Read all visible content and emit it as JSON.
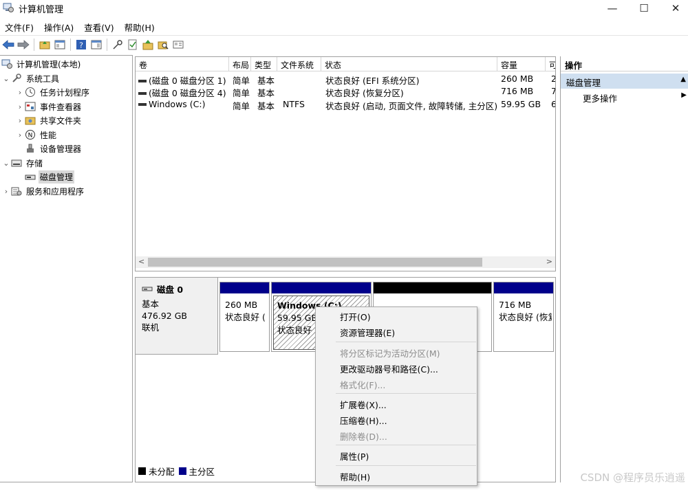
{
  "window": {
    "title": "计算机管理",
    "minimize": "—",
    "maximize": "☐",
    "close": "✕"
  },
  "menubar": [
    "文件(F)",
    "操作(A)",
    "查看(V)",
    "帮助(H)"
  ],
  "tree": {
    "root": "计算机管理(本地)",
    "system_tools": "系统工具",
    "task_scheduler": "任务计划程序",
    "event_viewer": "事件查看器",
    "shared_folders": "共享文件夹",
    "performance": "性能",
    "device_manager": "设备管理器",
    "storage": "存储",
    "disk_management": "磁盘管理",
    "services_apps": "服务和应用程序"
  },
  "volume_list": {
    "columns": [
      "卷",
      "布局",
      "类型",
      "文件系统",
      "状态",
      "容量",
      "可"
    ],
    "rows": [
      {
        "volume": "(磁盘 0 磁盘分区 1)",
        "layout": "简单",
        "type": "基本",
        "fs": "",
        "status": "状态良好 (EFI 系统分区)",
        "capacity": "260 MB",
        "free": "2"
      },
      {
        "volume": "(磁盘 0 磁盘分区 4)",
        "layout": "简单",
        "type": "基本",
        "fs": "",
        "status": "状态良好 (恢复分区)",
        "capacity": "716 MB",
        "free": "7"
      },
      {
        "volume": "Windows  (C:)",
        "layout": "简单",
        "type": "基本",
        "fs": "NTFS",
        "status": "状态良好 (启动, 页面文件, 故障转储, 主分区)",
        "capacity": "59.95 GB",
        "free": "6"
      }
    ]
  },
  "disk": {
    "name": "磁盘 0",
    "type": "基本",
    "size": "476.92 GB",
    "state": "联机",
    "partitions": [
      {
        "size": "260 MB",
        "status": "状态良好 ("
      },
      {
        "title": "Windows   (C:)",
        "size": "59.95 GB",
        "status": "状态良好 ("
      },
      {
        "size": "",
        "status": ""
      },
      {
        "size": "716 MB",
        "status": "状态良好 (恢复"
      }
    ]
  },
  "legend": {
    "unallocated": "未分配",
    "primary": "主分区"
  },
  "actions": {
    "header": "操作",
    "section": "磁盘管理",
    "more": "更多操作"
  },
  "context_menu": {
    "open": "打开(O)",
    "explore": "资源管理器(E)",
    "mark_active": "将分区标记为活动分区(M)",
    "change_letter": "更改驱动器号和路径(C)...",
    "format": "格式化(F)...",
    "extend": "扩展卷(X)...",
    "shrink": "压缩卷(H)...",
    "delete": "删除卷(D)...",
    "properties": "属性(P)",
    "help": "帮助(H)"
  },
  "watermark": "CSDN @程序员乐逍遥",
  "colors": {
    "primary_partition": "#00008b",
    "unallocated": "#000000",
    "selection": "#cfdff0"
  }
}
